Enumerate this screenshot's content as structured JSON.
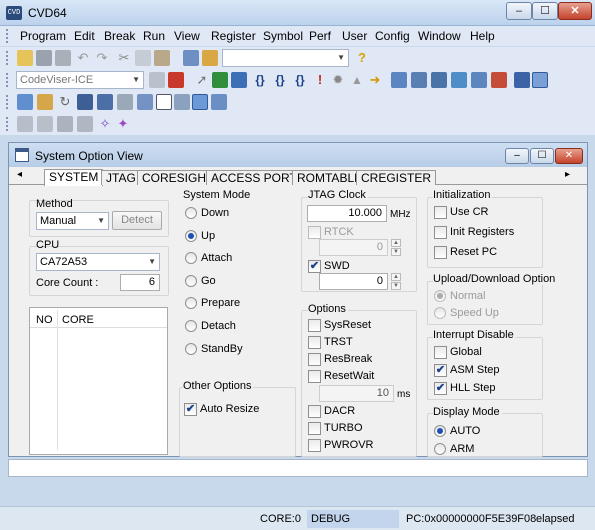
{
  "window": {
    "title": "CVD64",
    "app_icon": "CVD",
    "minimize": "‒",
    "maximize": "☐",
    "close": "✕"
  },
  "menu": [
    "Program",
    "Edit",
    "Break",
    "Run",
    "View",
    "Register",
    "Symbol",
    "Perf",
    "User",
    "Config",
    "Window",
    "Help"
  ],
  "toolbar": {
    "target_combo": "CodeViser-ICE",
    "empty_combo": ""
  },
  "child": {
    "title": "System Option View",
    "tabs": [
      "SYSTEM",
      "JTAG",
      "CORESIGHT",
      "ACCESS PORTS",
      "ROMTABLE",
      "CREGISTER"
    ],
    "tab_left": "◂",
    "tab_right": "▸",
    "method": {
      "label": "Method",
      "value": "Manual",
      "detect": "Detect"
    },
    "cpu": {
      "label": "CPU",
      "value": "CA72A53",
      "core_count_label": "Core Count :",
      "core_count": "6",
      "columns": [
        "NO",
        "CORE"
      ]
    },
    "system_mode": {
      "label": "System Mode",
      "options": [
        "Down",
        "Up",
        "Attach",
        "Go",
        "Prepare",
        "Detach",
        "StandBy"
      ],
      "selected": "Up"
    },
    "other_options": {
      "label": "Other Options",
      "auto_resize": "Auto Resize",
      "auto_resize_checked": true
    },
    "jtag_clock": {
      "label": "JTAG Clock",
      "value": "10.000",
      "unit": "MHz",
      "rtck": "RTCK",
      "rtck_value": "0",
      "swd": "SWD",
      "swd_checked": true,
      "swd_value": "0"
    },
    "options": {
      "label": "Options",
      "items": [
        "SysReset",
        "TRST",
        "ResBreak",
        "ResetWait"
      ],
      "reset_wait_value": "10",
      "reset_wait_unit": "ms",
      "items2": [
        "DACR",
        "TURBO",
        "PWROVR"
      ]
    },
    "initialization": {
      "label": "Initialization",
      "items": [
        "Use CR",
        "Init Registers",
        "Reset PC"
      ]
    },
    "upload": {
      "label": "Upload/Download Option",
      "options": [
        "Normal",
        "Speed Up"
      ],
      "selected": "Normal"
    },
    "interrupt": {
      "label": "Interrupt Disable",
      "items": [
        "Global",
        "ASM Step",
        "HLL Step"
      ],
      "checked": [
        "ASM Step",
        "HLL Step"
      ]
    },
    "display_mode": {
      "label": "Display Mode",
      "options": [
        "AUTO",
        "ARM"
      ],
      "selected": "AUTO"
    }
  },
  "status": {
    "core": "CORE:0",
    "state": "DEBUG",
    "pc": "PC:0x00000000F5E39F08",
    "elapsed": "elapsed"
  }
}
